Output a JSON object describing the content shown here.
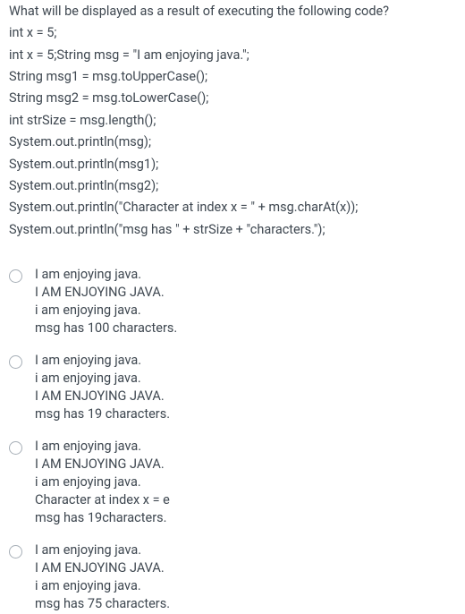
{
  "question": "What will be displayed as a result of executing the following code?",
  "code": [
    "int x = 5;",
    "int x = 5;String msg = \"I am enjoying java.\";",
    "String msg1 = msg.toUpperCase();",
    "String msg2 = msg.toLowerCase();",
    "int strSize = msg.length();",
    "System.out.println(msg);",
    "System.out.println(msg1);",
    "System.out.println(msg2);",
    "System.out.println(\"Character at index x = \" + msg.charAt(x));",
    "System.out.println(\"msg has \" + strSize + \"characters.\");"
  ],
  "options": [
    {
      "lines": [
        "I am enjoying java.",
        "I AM ENJOYING JAVA.",
        "i am enjoying java.",
        "msg has 100 characters."
      ]
    },
    {
      "lines": [
        "I am enjoying java.",
        "i am enjoying java.",
        "I AM ENJOYING JAVA.",
        "msg has 19 characters."
      ]
    },
    {
      "lines": [
        "I am enjoying java.",
        "I AM ENJOYING JAVA.",
        "i am enjoying java.",
        "Character at index x = e",
        "msg has 19characters."
      ]
    },
    {
      "lines": [
        "I am enjoying java.",
        "I AM ENJOYING JAVA.",
        "i am enjoying java.",
        "msg has 75 characters."
      ]
    }
  ]
}
